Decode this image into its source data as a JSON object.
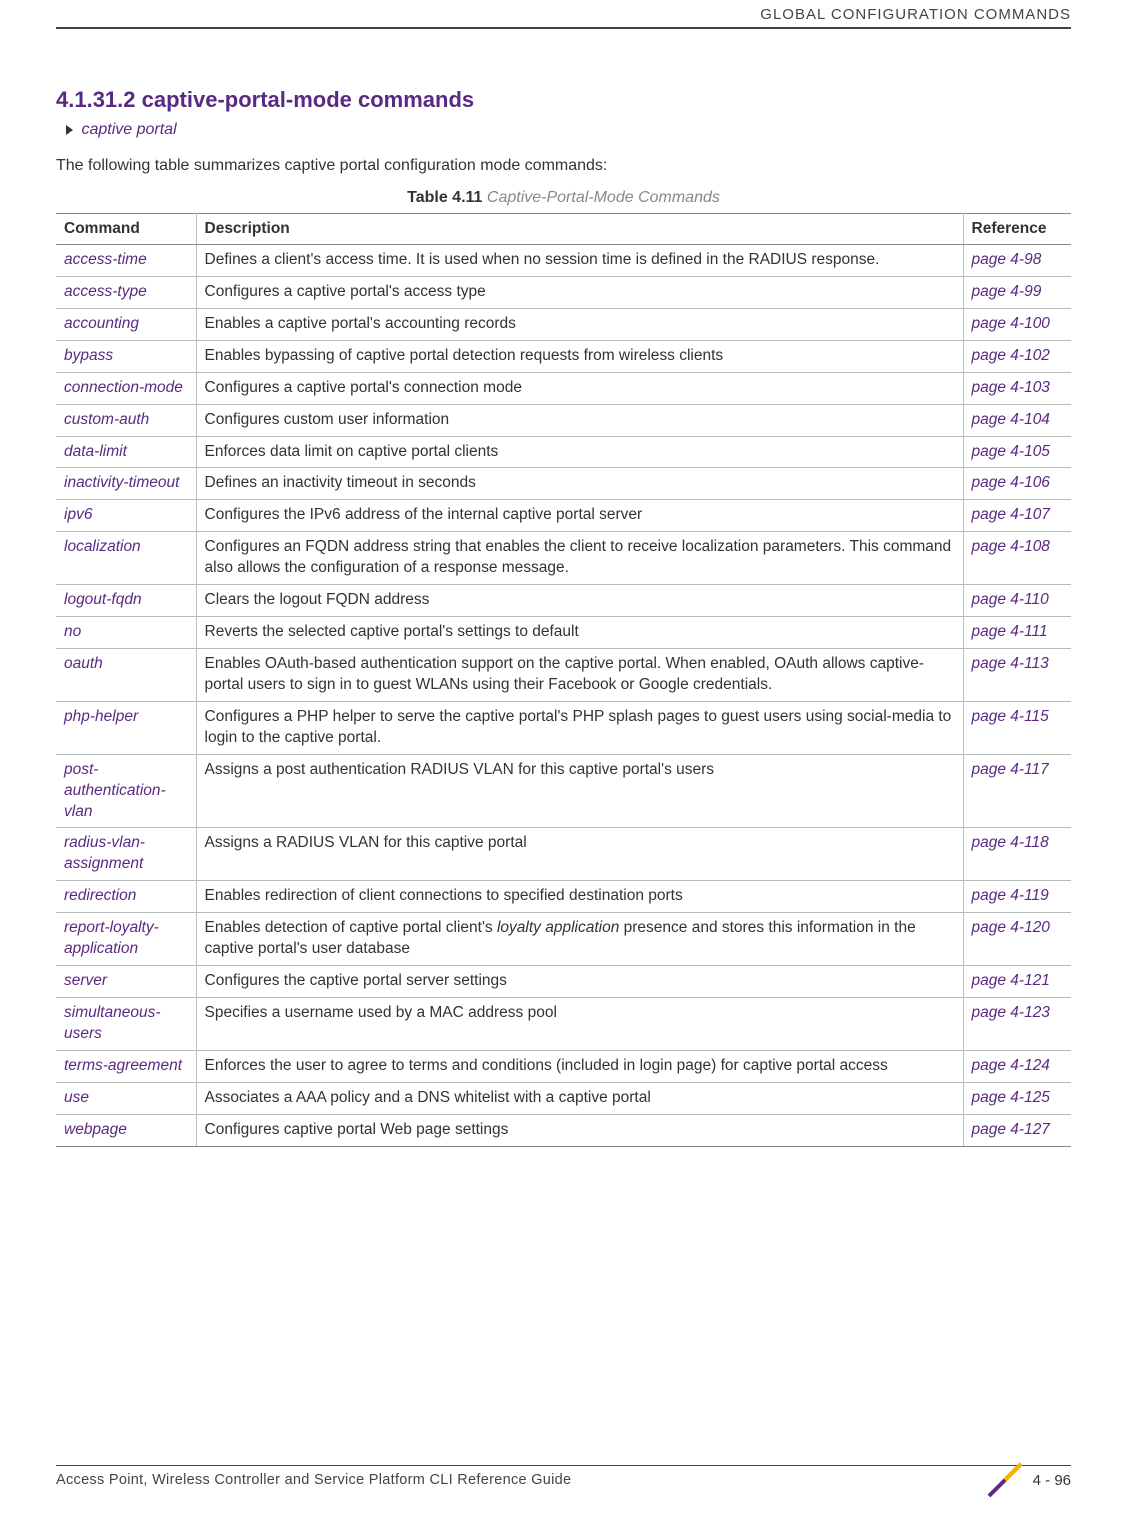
{
  "header": {
    "title": "GLOBAL CONFIGURATION COMMANDS"
  },
  "section": {
    "heading": "4.1.31.2 captive-portal-mode commands",
    "breadcrumb": "captive portal",
    "intro": "The following table summarizes captive portal configuration mode commands:",
    "table_label": "Table 4.11",
    "table_title": "Captive-Portal-Mode Commands"
  },
  "table": {
    "headers": {
      "command": "Command",
      "description": "Description",
      "reference": "Reference"
    },
    "rows": [
      {
        "cmd": "access-time",
        "desc": "Defines a client's access time. It is used when no session time is defined in the RADIUS response.",
        "ref": "page 4-98"
      },
      {
        "cmd": "access-type",
        "desc": "Configures a captive portal's access type",
        "ref": "page 4-99"
      },
      {
        "cmd": "accounting",
        "desc": "Enables a captive portal's accounting records",
        "ref": "page 4-100"
      },
      {
        "cmd": "bypass",
        "desc": "Enables bypassing of captive portal detection requests from wireless clients",
        "ref": "page 4-102"
      },
      {
        "cmd": "connection-mode",
        "desc": "Configures a captive portal's connection mode",
        "ref": "page 4-103"
      },
      {
        "cmd": "custom-auth",
        "desc": "Configures custom user information",
        "ref": "page 4-104"
      },
      {
        "cmd": "data-limit",
        "desc": "Enforces data limit on captive portal clients",
        "ref": "page 4-105"
      },
      {
        "cmd": "inactivity-timeout",
        "desc": "Defines an inactivity timeout in seconds",
        "ref": "page 4-106"
      },
      {
        "cmd": "ipv6",
        "desc": "Configures the IPv6 address of the internal captive portal server",
        "ref": "page 4-107"
      },
      {
        "cmd": "localization",
        "desc": "Configures an FQDN address string that enables the client to receive localization parameters. This command also allows the configuration of a response message.",
        "ref": "page 4-108"
      },
      {
        "cmd": "logout-fqdn",
        "desc": "Clears the logout FQDN address",
        "ref": "page 4-110"
      },
      {
        "cmd": "no",
        "desc": "Reverts the selected captive portal's settings to default",
        "ref": "page 4-111"
      },
      {
        "cmd": "oauth",
        "desc": "Enables OAuth-based authentication support on the captive portal. When enabled, OAuth allows captive-portal users to sign in to guest WLANs using their Facebook or Google credentials.",
        "ref": "page 4-113"
      },
      {
        "cmd": "php-helper",
        "desc": "Configures a PHP helper to serve the captive portal's PHP splash pages to guest users using social-media to login to the captive portal.",
        "ref": "page 4-115"
      },
      {
        "cmd": "post-authentication-vlan",
        "desc": "Assigns a post authentication RADIUS VLAN for this captive portal's users",
        "ref": "page 4-117"
      },
      {
        "cmd": "radius-vlan-assignment",
        "desc": "Assigns a RADIUS VLAN for this captive portal",
        "ref": "page 4-118"
      },
      {
        "cmd": "redirection",
        "desc": "Enables redirection of client connections to specified destination ports",
        "ref": "page 4-119"
      },
      {
        "cmd": "report-loyalty-application",
        "desc_pre": "Enables detection of captive portal client's ",
        "desc_italic": "loyalty application",
        "desc_post": " presence and stores this information in the captive portal's user database",
        "ref": "page 4-120"
      },
      {
        "cmd": "server",
        "desc": "Configures the captive portal server settings",
        "ref": "page 4-121"
      },
      {
        "cmd": "simultaneous-users",
        "desc": "Specifies a username used by a MAC address pool",
        "ref": "page 4-123"
      },
      {
        "cmd": "terms-agreement",
        "desc": "Enforces the user to agree to terms and conditions (included in login page) for captive portal access",
        "ref": "page 4-124"
      },
      {
        "cmd": "use",
        "desc": "Associates a AAA policy and a DNS whitelist with a captive portal",
        "ref": "page 4-125"
      },
      {
        "cmd": "webpage",
        "desc": "Configures captive portal Web page settings",
        "ref": "page 4-127"
      }
    ]
  },
  "footer": {
    "text": "Access Point, Wireless Controller and Service Platform CLI Reference Guide",
    "page": "4 - 96"
  }
}
